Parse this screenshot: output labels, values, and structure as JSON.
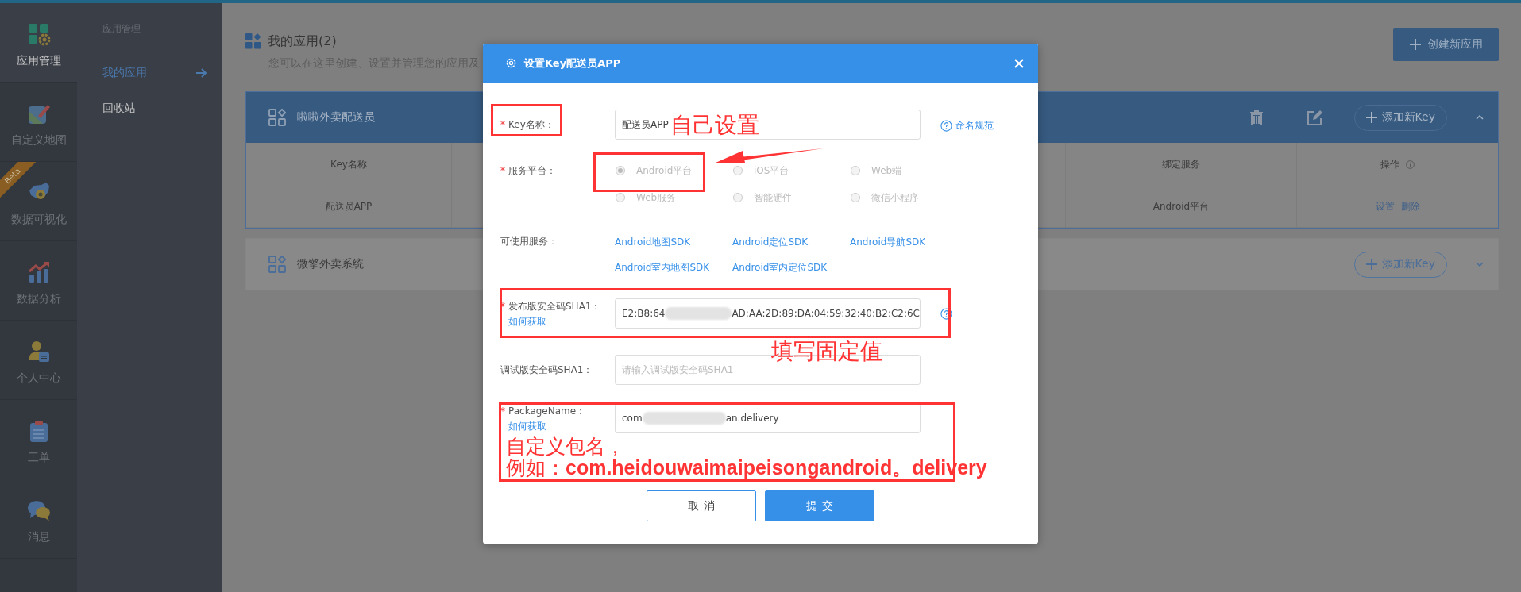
{
  "top_nav": [
    {
      "label": "应用管理",
      "selected": true
    },
    {
      "label": "自定义地图",
      "selected": false
    },
    {
      "label": "数据可视化",
      "selected": false,
      "badge": "Beta"
    },
    {
      "label": "数据分析",
      "selected": false
    },
    {
      "label": "个人中心",
      "selected": false
    },
    {
      "label": "工单",
      "selected": false
    },
    {
      "label": "消息",
      "selected": false
    }
  ],
  "submenu": {
    "title": "应用管理",
    "items": [
      {
        "label": "我的应用",
        "selected": true
      },
      {
        "label": "回收站",
        "selected": false
      }
    ]
  },
  "page": {
    "title": "我的应用(2)",
    "subtitle": "您可以在这里创建、设置并管理您的应用及",
    "create_button": "创建新应用"
  },
  "apps": [
    {
      "name": "啦啦外卖配送员",
      "expanded": true,
      "add_key_button": "添加新Key",
      "table": {
        "columns": [
          "Key名称",
          "绑定服务",
          "操作"
        ],
        "rows": [
          {
            "key_name": "配送员APP",
            "bound_service": "Android平台",
            "actions": [
              "设置",
              "删除"
            ]
          }
        ]
      }
    },
    {
      "name": "微擎外卖系统",
      "expanded": false,
      "add_key_button": "添加新Key"
    }
  ],
  "dialog": {
    "title": "设置Key配送员APP",
    "key_name": {
      "asterisk": "*",
      "label": "Key名称：",
      "value": "配送员APP",
      "help_link": "命名规范"
    },
    "platform": {
      "asterisk": "*",
      "label": "服务平台：",
      "options": [
        {
          "label": "Android平台",
          "selected": true,
          "disabled": true
        },
        {
          "label": "iOS平台",
          "selected": false,
          "disabled": true
        },
        {
          "label": "Web端",
          "selected": false,
          "disabled": true
        },
        {
          "label": "Web服务",
          "selected": false,
          "disabled": true
        },
        {
          "label": "智能硬件",
          "selected": false,
          "disabled": true
        },
        {
          "label": "微信小程序",
          "selected": false,
          "disabled": true
        }
      ]
    },
    "services": {
      "label": "可使用服务：",
      "links": [
        "Android地图SDK",
        "Android定位SDK",
        "Android导航SDK",
        "Android室内地图SDK",
        "Android室内定位SDK"
      ]
    },
    "release_sha1": {
      "asterisk": "*",
      "label": "发布版安全码SHA1：",
      "value_parts": [
        "E2:B8:64",
        "AD:AA:2D:89:DA:04:59:32:40:B2:C2:6C"
      ],
      "help_link": "如何获取"
    },
    "debug_sha1": {
      "label": "调试版安全码SHA1：",
      "placeholder": "请输入调试版安全码SHA1"
    },
    "package_name": {
      "asterisk": "*",
      "label": "PackageName：",
      "value_parts": [
        "com",
        "an.delivery"
      ],
      "help_link": "如何获取"
    },
    "buttons": [
      {
        "label": "取消",
        "kind": "secondary"
      },
      {
        "label": "提交",
        "kind": "primary"
      }
    ]
  },
  "annotations": {
    "key_note": "自己设置",
    "sha1_note": "填写固定值",
    "package_note": [
      "自定义包名，",
      "例如：**com.heidouwaimaipeisongandroid。delivery**"
    ]
  }
}
